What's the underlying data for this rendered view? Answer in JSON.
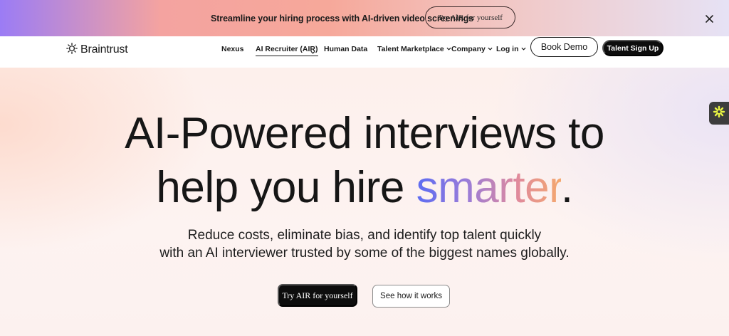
{
  "banner": {
    "message": "Streamline your hiring process with AI-driven video screenings",
    "cta_label": "Try AIR for yourself",
    "close_icon": "close-icon"
  },
  "header": {
    "logo_text": "Braintrust",
    "logo_icon": "sun-logo-icon",
    "nav": [
      {
        "label": "Nexus"
      },
      {
        "label": "AI Recruiter (AIR)"
      },
      {
        "label": "Human Data"
      },
      {
        "label": "Talent Marketplace"
      },
      {
        "label": "Company"
      },
      {
        "label": "Log in"
      }
    ],
    "book_demo_label": "Book Demo",
    "signup_label": "Talent Sign Up"
  },
  "hero": {
    "headline_line1": "AI-Powered interviews to",
    "headline_line2_prefix": "help you hire ",
    "headline_highlight": "smarter",
    "headline_suffix": ".",
    "subtext_line1": "Reduce costs, eliminate bias, and identify top talent quickly",
    "subtext_line2": "with an AI interviewer trusted by some of the biggest names globally.",
    "primary_cta": "Try AIR for yourself",
    "secondary_cta": "See how it works"
  },
  "side_widget": {
    "icon": "asterisk-flower-icon",
    "accent": "#e9f542"
  },
  "colors": {
    "highlight_gradient": [
      "#5d6cf2",
      "#9a7cd8",
      "#e08a9c",
      "#f4a86e"
    ],
    "button_dark": "#0d0d0d"
  }
}
